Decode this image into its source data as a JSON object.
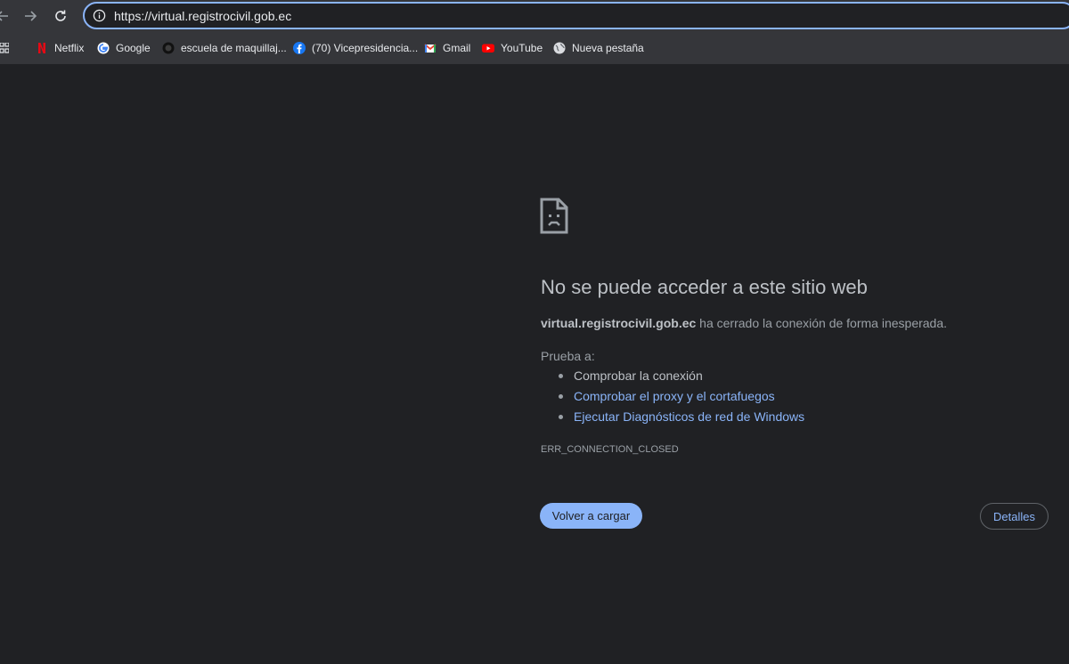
{
  "browser": {
    "url": "https://virtual.registrocivil.gob.ec",
    "bookmarks": [
      {
        "label": "Netflix",
        "icon": "netflix-icon"
      },
      {
        "label": "Google",
        "icon": "google-icon"
      },
      {
        "label": "escuela de maquillaj...",
        "icon": "circle-site-icon"
      },
      {
        "label": "(70) Vicepresidencia...",
        "icon": "facebook-icon"
      },
      {
        "label": "Gmail",
        "icon": "gmail-icon"
      },
      {
        "label": "YouTube",
        "icon": "youtube-icon"
      },
      {
        "label": "Nueva pestaña",
        "icon": "globe-icon"
      }
    ]
  },
  "error": {
    "title": "No se puede acceder a este sitio web",
    "host": "virtual.registrocivil.gob.ec",
    "message": " ha cerrado la conexión de forma inesperada.",
    "try_label": "Prueba a:",
    "suggestions": [
      {
        "text": "Comprobar la conexión",
        "link": false
      },
      {
        "text": "Comprobar el proxy y el cortafuegos",
        "link": true
      },
      {
        "text": "Ejecutar Diagnósticos de red de Windows",
        "link": true
      }
    ],
    "code": "ERR_CONNECTION_CLOSED",
    "reload_label": "Volver a cargar",
    "details_label": "Detalles"
  },
  "colors": {
    "background": "#202124",
    "toolbar": "#35363a",
    "accent": "#8ab4f8",
    "text_primary": "#bdc1c6",
    "text_secondary": "#9aa0a6"
  }
}
